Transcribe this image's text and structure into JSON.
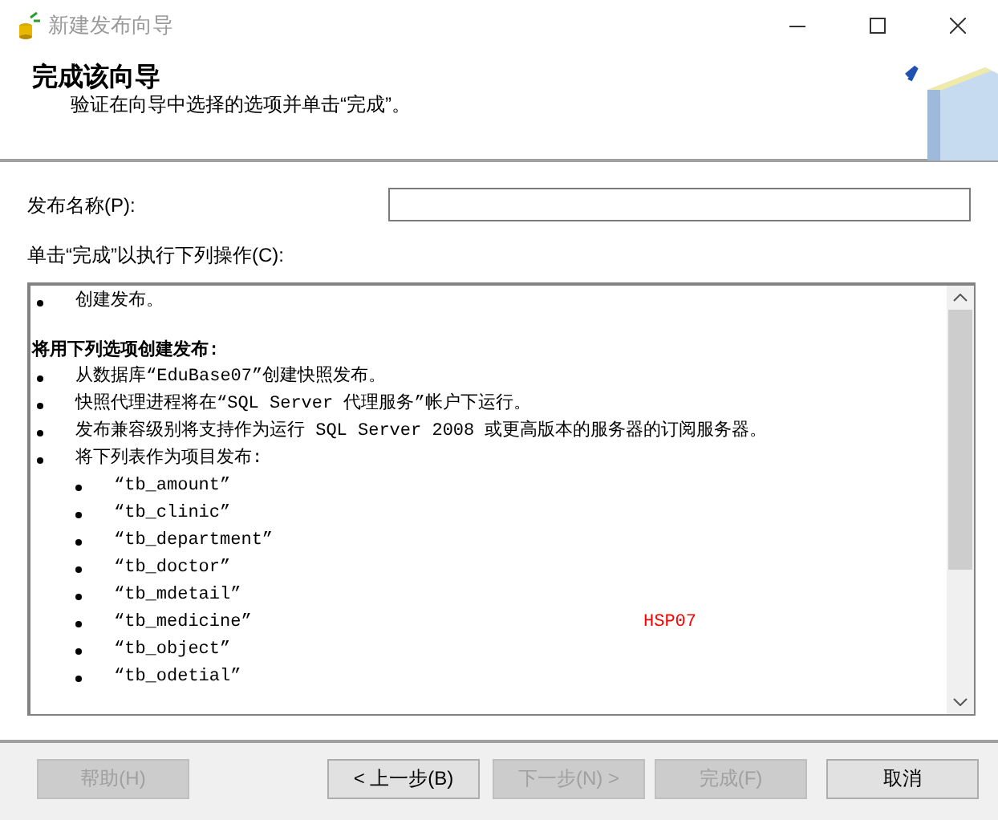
{
  "window": {
    "title": "新建发布向导"
  },
  "header": {
    "title": "完成该向导",
    "subtitle": "验证在向导中选择的选项并单击“完成”。"
  },
  "name_field": {
    "label": "发布名称(P):"
  },
  "actions_label": "单击“完成”以执行下列操作(C):",
  "actions": [
    {
      "kind": "bullet",
      "text": "创建发布。"
    },
    {
      "kind": "blank"
    },
    {
      "kind": "heading",
      "text": "将用下列选项创建发布:"
    },
    {
      "kind": "bullet",
      "text": "从数据库“EduBase07”创建快照发布。"
    },
    {
      "kind": "bullet",
      "text": "快照代理进程将在“SQL Server 代理服务”帐户下运行。"
    },
    {
      "kind": "bullet",
      "text": "发布兼容级别将支持作为运行 SQL Server 2008 或更高版本的服务器的订阅服务器。"
    },
    {
      "kind": "bullet",
      "text": "将下列表作为项目发布:"
    },
    {
      "kind": "sub",
      "text": "“tb_amount”"
    },
    {
      "kind": "sub",
      "text": "“tb_clinic”"
    },
    {
      "kind": "sub",
      "text": "“tb_department”"
    },
    {
      "kind": "sub",
      "text": "“tb_doctor”"
    },
    {
      "kind": "sub",
      "text": "“tb_mdetail”"
    },
    {
      "kind": "sub",
      "text": "“tb_medicine”",
      "note": "HSP07",
      "color": "#ff0000"
    },
    {
      "kind": "sub",
      "text": "“tb_object”"
    },
    {
      "kind": "sub",
      "text": "“tb_odetial”"
    }
  ],
  "buttons": [
    {
      "label": "帮助(H)",
      "disabled": true
    },
    {
      "label": "< 上一步(B)",
      "disabled": false
    },
    {
      "label": "下一步(N) >",
      "disabled": true
    },
    {
      "label": "完成(F)",
      "disabled": true
    },
    {
      "label": "取消",
      "disabled": false
    }
  ]
}
